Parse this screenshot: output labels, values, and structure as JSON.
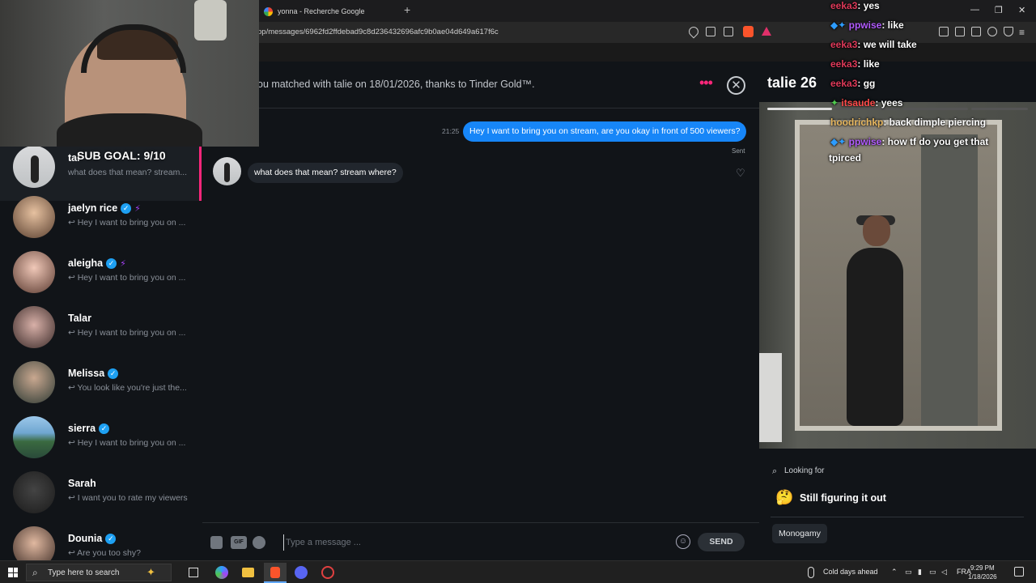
{
  "browser": {
    "tab_title": "yonna - Recherche Google",
    "new_tab_icon": "plus-icon",
    "url": "pp/messages/6962fd2ffdebad9c8d236432696afc9b0ae04d649a617f6c"
  },
  "header": {
    "match_text": "ou matched with talie on 18/01/2026, thanks to Tinder Gold™.",
    "more_icon": "more-dots-icon",
    "close_icon": "close-circle-icon"
  },
  "sidebar": {
    "items": [
      {
        "name": "tal",
        "preview": "what does that mean? stream...",
        "verified": false,
        "bolt": false,
        "arrow": false
      },
      {
        "name": "jaelyn rice",
        "preview": "↩ Hey I want to bring you on ...",
        "verified": true,
        "bolt": true,
        "arrow": true
      },
      {
        "name": "aleigha",
        "preview": "↩ Hey I want to bring you on ...",
        "verified": true,
        "bolt": true,
        "arrow": true
      },
      {
        "name": "Talar",
        "preview": "↩ Hey I want to bring you on ...",
        "verified": false,
        "bolt": false,
        "arrow": true
      },
      {
        "name": "Melissa",
        "preview": "↩ You look like you're just the...",
        "verified": true,
        "bolt": false,
        "arrow": true
      },
      {
        "name": "sierra",
        "preview": "↩ Hey I want to bring you on ...",
        "verified": true,
        "bolt": false,
        "arrow": true
      },
      {
        "name": "Sarah",
        "preview": "↩ I want you to rate my viewers",
        "verified": false,
        "bolt": false,
        "arrow": true
      },
      {
        "name": "Dounia",
        "preview": "↩ Are you too shy?",
        "verified": true,
        "bolt": false,
        "arrow": true
      }
    ]
  },
  "chat": {
    "outgoing": {
      "time": "21:25",
      "text": "Hey I want to bring you on stream, are you okay in front of 500 viewers?",
      "status": "Sent"
    },
    "incoming": {
      "text": "what does that mean? stream where?"
    }
  },
  "composer": {
    "placeholder": "Type a message ...",
    "gif_label": "GIF",
    "send_label": "SEND"
  },
  "profile": {
    "name_age": "talie 26",
    "looking_for_label": "Looking for",
    "looking_for_value": "Still figuring it out",
    "looking_for_emoji": "🤔",
    "chip": "Monogamy"
  },
  "stream_overlay": {
    "sub_goal": "SUB GOAL: 9/10",
    "chat": [
      {
        "user": "eeka3",
        "color": "#e03a5a",
        "msg": ": yes"
      },
      {
        "user": "ppwise",
        "color": "#b25bff",
        "msg": ": like"
      },
      {
        "user": "eeka3",
        "color": "#e03a5a",
        "msg": ": we will take"
      },
      {
        "user": "eeka3",
        "color": "#e03a5a",
        "msg": ": like"
      },
      {
        "user": "eeka3",
        "color": "#e03a5a",
        "msg": ": gg"
      },
      {
        "user": "itsaude",
        "color": "#ff4a4a",
        "msg": ": yees"
      },
      {
        "user": "hoodrichkp",
        "color": "#e8b860",
        "msg": ": back dimple piercing"
      },
      {
        "user": "ppwise",
        "color": "#b25bff",
        "msg": ": how tf do you get that"
      },
      {
        "user": "",
        "color": "#ffffff",
        "msg": "tpirced"
      }
    ]
  },
  "taskbar": {
    "search_placeholder": "Type here to search",
    "weather": "Cold days ahead",
    "lang": "FRA",
    "time": "9:29 PM",
    "date": "1/18/2026"
  }
}
